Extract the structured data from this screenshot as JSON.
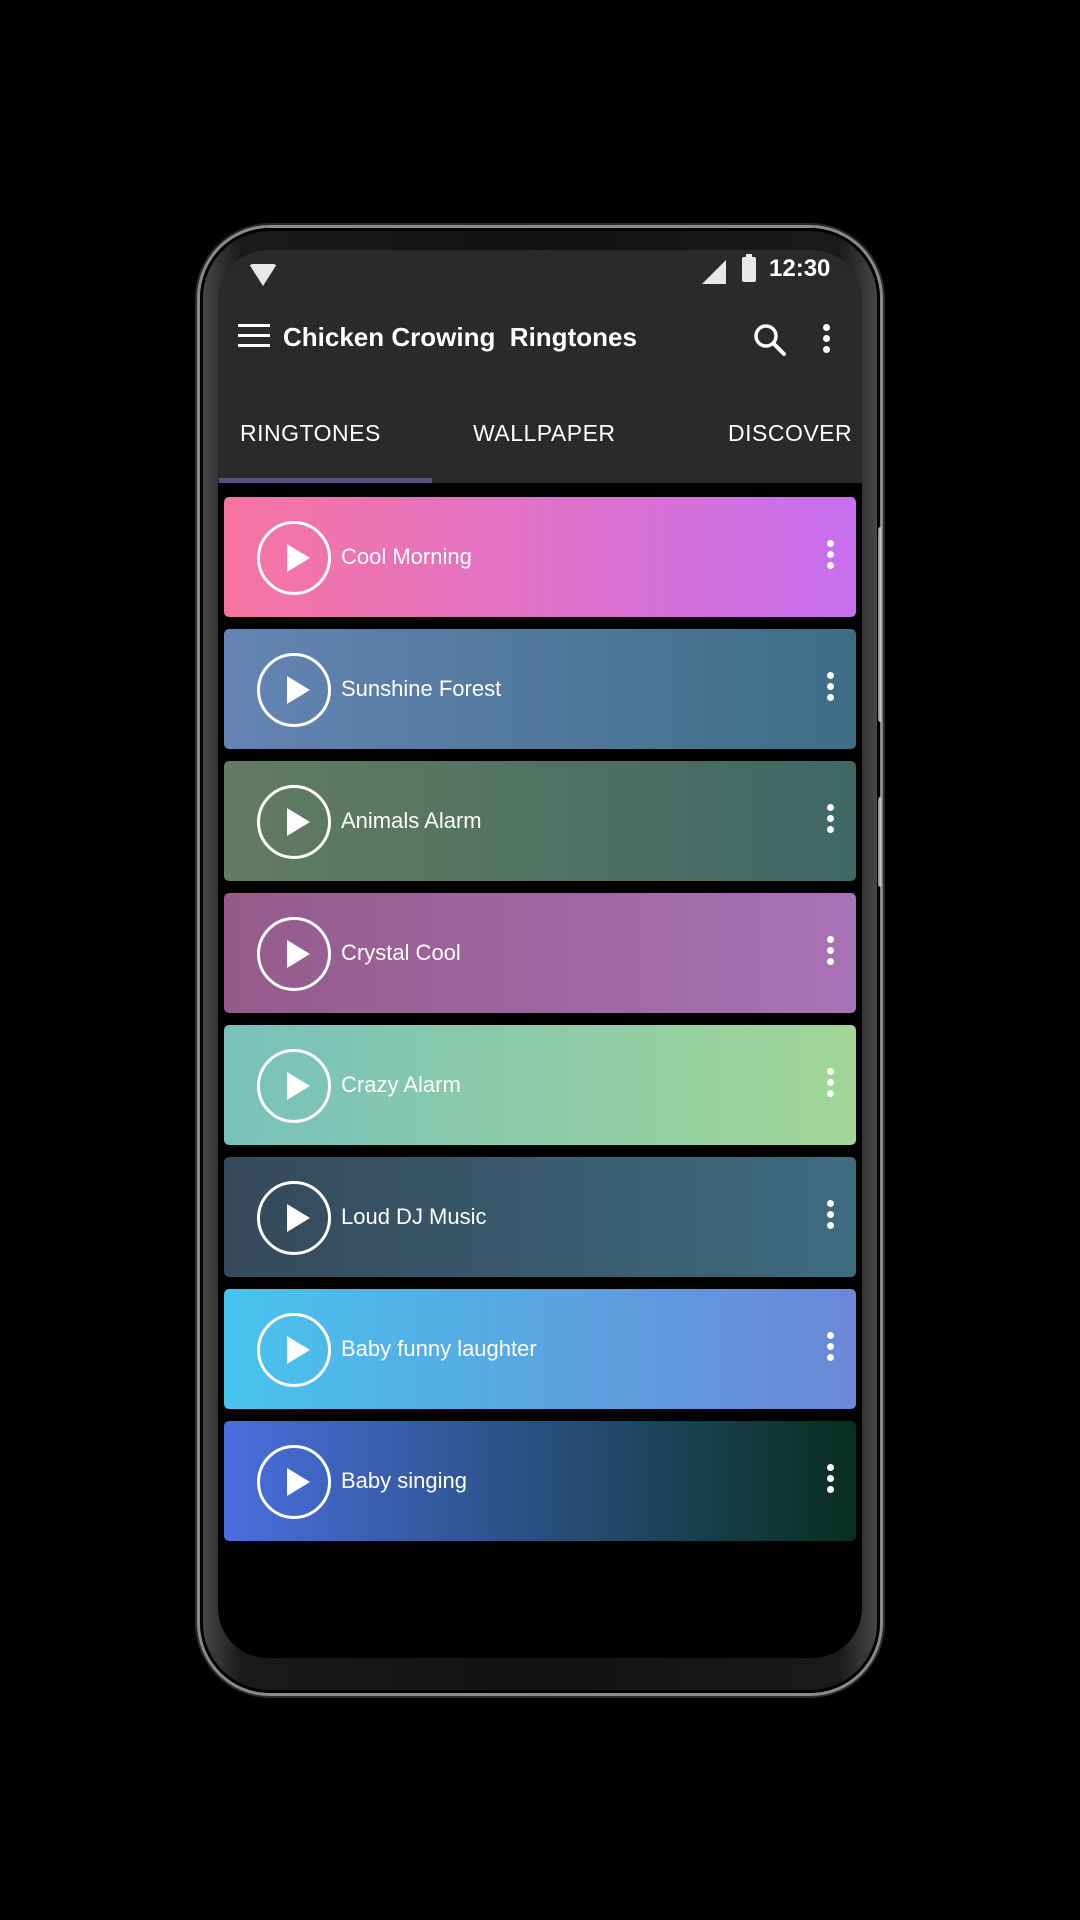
{
  "status_bar": {
    "time": "12:30",
    "icons": [
      "wifi-icon",
      "signal-icon",
      "battery-icon"
    ]
  },
  "app_bar": {
    "title": "Chicken Crowing  Ringtones",
    "icons": [
      "menu-icon",
      "search-icon",
      "more-vert-icon"
    ]
  },
  "tabs": [
    {
      "label": "RINGTONES",
      "selected": true
    },
    {
      "label": "WALLPAPER",
      "selected": false
    },
    {
      "label": "DISCOVER",
      "selected": false
    }
  ],
  "ringtones": [
    {
      "title": "Cool Morning",
      "colors": [
        "#f774a0",
        "#c86ff0"
      ]
    },
    {
      "title": "Sunshine Forest",
      "colors": [
        "#6584b4",
        "#3d6d85"
      ]
    },
    {
      "title": "Animals Alarm",
      "colors": [
        "#637c62",
        "#3f6764"
      ]
    },
    {
      "title": "Crystal Cool",
      "colors": [
        "#945b8a",
        "#a872b6"
      ]
    },
    {
      "title": "Crazy Alarm",
      "colors": [
        "#78c1bb",
        "#a2d697"
      ]
    },
    {
      "title": "Loud DJ Music",
      "colors": [
        "#35495a",
        "#3e6b80"
      ]
    },
    {
      "title": "Baby funny laughter",
      "colors": [
        "#48c3ee",
        "#6b87d6"
      ]
    },
    {
      "title": "Baby singing",
      "colors": [
        "#4a6ede",
        "#082f1e"
      ]
    }
  ],
  "accent_color": "#5a4e86"
}
